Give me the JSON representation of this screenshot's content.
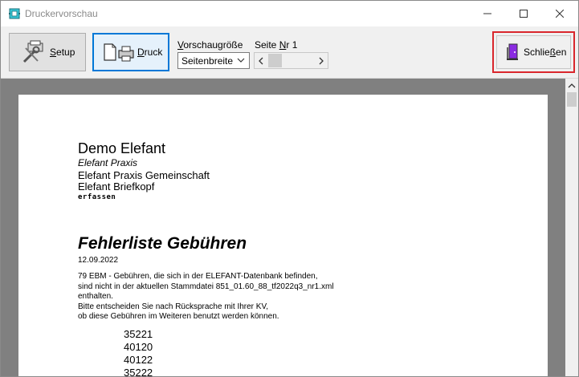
{
  "window": {
    "title": "Druckervorschau",
    "icon": "printer-preview-icon"
  },
  "toolbar": {
    "setup_label_u": "S",
    "setup_label_rest": "etup",
    "druck_label_u": "D",
    "druck_label_rest": "ruck",
    "vorschau_label_u": "V",
    "vorschau_label_rest": "orschaugröße",
    "vorschau_value": "Seitenbreite",
    "page_label_pre": "Seite ",
    "page_label_u": "N",
    "page_label_post": "r 1",
    "close_label_pre": "Schlie",
    "close_label_u": "ß",
    "close_label_post": "en"
  },
  "page": {
    "header": {
      "name": "Demo Elefant",
      "subtitle": "Elefant Praxis",
      "line1": "Elefant Praxis Gemeinschaft",
      "line2": "Elefant Briefkopf",
      "line3": "erfassen"
    },
    "error_title": "Fehlerliste Gebühren",
    "date": "12.09.2022",
    "text_lines": [
      "79 EBM - Gebühren, die sich in der ELEFANT-Datenbank befinden,",
      "sind nicht in der aktuellen Stammdatei 851_01.60_88_tf2022q3_nr1.xml",
      "enthalten.",
      "Bitte entscheiden Sie nach Rücksprache mit Ihrer KV,",
      "ob diese Gebühren im Weiteren benutzt werden können."
    ],
    "codes": [
      "35221",
      "40120",
      "40122",
      "35222"
    ]
  },
  "colors": {
    "accent": "#0078d7",
    "close_highlight": "#d9262c",
    "preview_bg": "#808080"
  }
}
